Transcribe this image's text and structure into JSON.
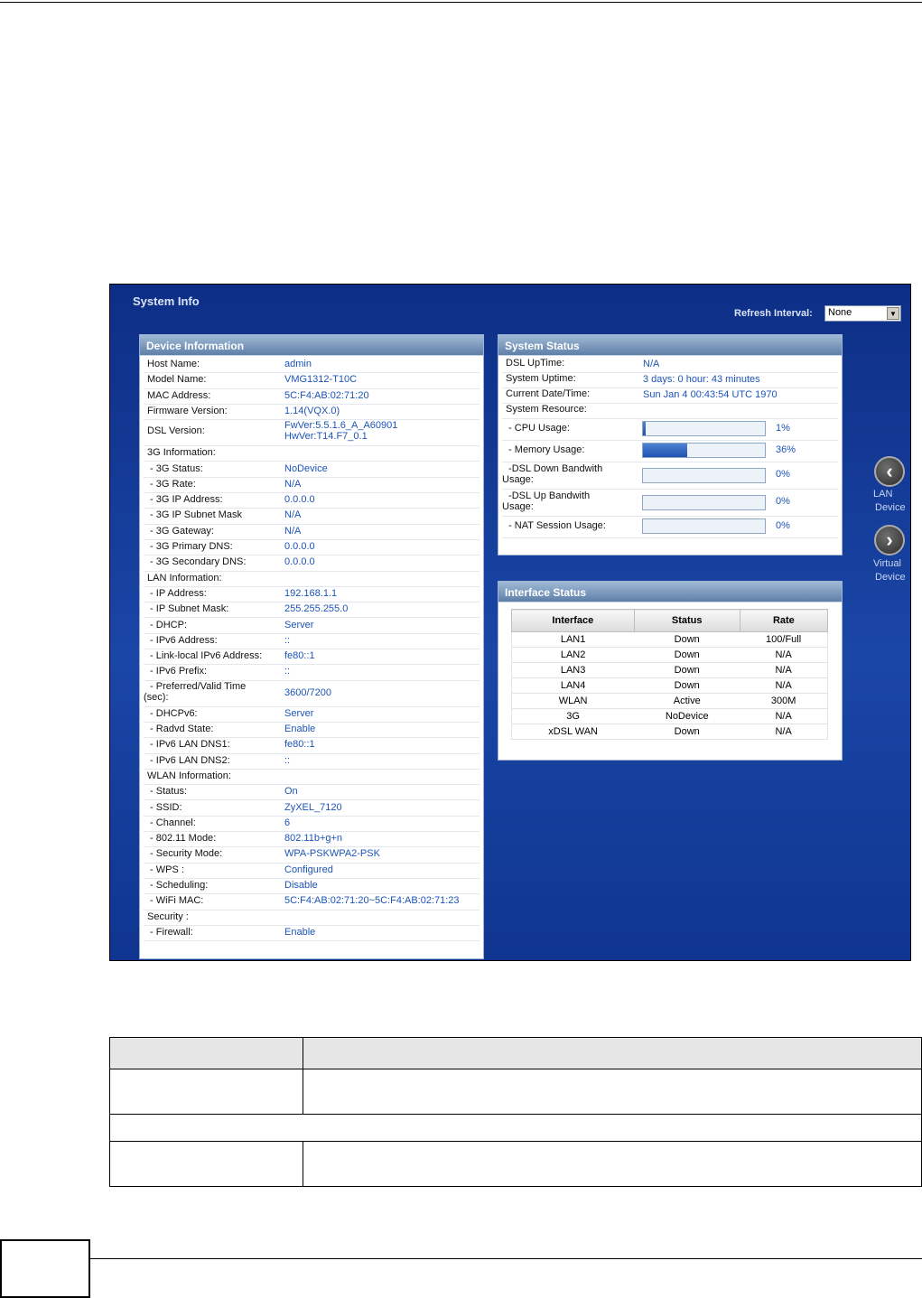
{
  "system_info": {
    "title": "System Info",
    "refresh_label": "Refresh Interval:",
    "refresh_value": "None"
  },
  "device_information": {
    "title": "Device Information",
    "rows": [
      {
        "label": "Host Name:",
        "value": "admin"
      },
      {
        "label": "Model Name:",
        "value": "VMG1312-T10C"
      },
      {
        "label": "MAC Address:",
        "value": "5C:F4:AB:02:71:20"
      },
      {
        "label": "Firmware Version:",
        "value": "1.14(VQX.0)"
      },
      {
        "label": "DSL Version:",
        "value": "FwVer:5.5.1.6_A_A60901",
        "value2": "HwVer:T14.F7_0.1"
      },
      {
        "label": "3G Information:",
        "value": ""
      },
      {
        "label": " - 3G Status:",
        "value": "NoDevice"
      },
      {
        "label": " - 3G Rate:",
        "value": "N/A"
      },
      {
        "label": " - 3G IP Address:",
        "value": "0.0.0.0"
      },
      {
        "label": " - 3G IP Subnet Mask",
        "value": "N/A"
      },
      {
        "label": " - 3G Gateway:",
        "value": "N/A"
      },
      {
        "label": " - 3G Primary DNS:",
        "value": "0.0.0.0"
      },
      {
        "label": " - 3G Secondary DNS:",
        "value": "0.0.0.0"
      },
      {
        "label": "LAN Information:",
        "value": ""
      },
      {
        "label": " - IP Address:",
        "value": "192.168.1.1"
      },
      {
        "label": " - IP Subnet Mask:",
        "value": "255.255.255.0"
      },
      {
        "label": " - DHCP:",
        "value": "Server"
      },
      {
        "label": " - IPv6 Address:",
        "value": "::"
      },
      {
        "label": " - Link-local IPv6 Address:",
        "value": "fe80::1"
      },
      {
        "label": " - IPv6 Prefix:",
        "value": "::"
      },
      {
        "label": " - Preferred/Valid Time",
        "label2": "(sec):",
        "value": "3600/7200"
      },
      {
        "label": " - DHCPv6:",
        "value": "Server"
      },
      {
        "label": " - Radvd State:",
        "value": "Enable"
      },
      {
        "label": " - IPv6 LAN DNS1:",
        "value": "fe80::1"
      },
      {
        "label": " - IPv6 LAN DNS2:",
        "value": "::"
      },
      {
        "label": "WLAN Information:",
        "value": ""
      },
      {
        "label": " - Status:",
        "value": "On"
      },
      {
        "label": " - SSID:",
        "value": "ZyXEL_7120"
      },
      {
        "label": " - Channel:",
        "value": "6"
      },
      {
        "label": " - 802.11 Mode:",
        "value": "802.11b+g+n"
      },
      {
        "label": " - Security Mode:",
        "value": "WPA-PSKWPA2-PSK"
      },
      {
        "label": " - WPS :",
        "value": "Configured"
      },
      {
        "label": " - Scheduling:",
        "value": "Disable"
      },
      {
        "label": " - WiFi MAC:",
        "value": "5C:F4:AB:02:71:20~5C:F4:AB:02:71:23"
      },
      {
        "label": "Security :",
        "value": ""
      },
      {
        "label": " - Firewall:",
        "value": "Enable"
      }
    ]
  },
  "system_status": {
    "title": "System Status",
    "dsl_uptime_label": "DSL UpTime:",
    "dsl_uptime": "N/A",
    "system_uptime_label": "System Uptime:",
    "system_uptime": "3 days: 0 hour: 43 minutes",
    "current_time_label": "Current Date/Time:",
    "current_time": "Sun Jan 4 00:43:54 UTC 1970",
    "resource_label": "System Resource:",
    "resources": [
      {
        "label": " - CPU Usage:",
        "percent_text": "1%",
        "fraction": 0.01
      },
      {
        "label": " - Memory Usage:",
        "percent_text": "36%",
        "fraction": 0.36
      },
      {
        "label": " -DSL Down Bandwith",
        "label2": "Usage:",
        "percent_text": "0%",
        "fraction": 0
      },
      {
        "label": " -DSL Up Bandwith",
        "label2": "Usage:",
        "percent_text": "0%",
        "fraction": 0
      },
      {
        "label": " - NAT Session Usage:",
        "percent_text": "0%",
        "fraction": 0
      }
    ]
  },
  "interface_status": {
    "title": "Interface Status",
    "headers": [
      "Interface",
      "Status",
      "Rate"
    ],
    "rows": [
      [
        "LAN1",
        "Down",
        "100/Full"
      ],
      [
        "LAN2",
        "Down",
        "N/A"
      ],
      [
        "LAN3",
        "Down",
        "N/A"
      ],
      [
        "LAN4",
        "Down",
        "N/A"
      ],
      [
        "WLAN",
        "Active",
        "300M"
      ],
      [
        "3G",
        "NoDevice",
        "N/A"
      ],
      [
        "xDSL WAN",
        "Down",
        "N/A"
      ]
    ]
  },
  "nav": {
    "lan_label_1": "LAN",
    "lan_label_2": "Device",
    "virtual_label_1": "Virtual",
    "virtual_label_2": "Device"
  }
}
